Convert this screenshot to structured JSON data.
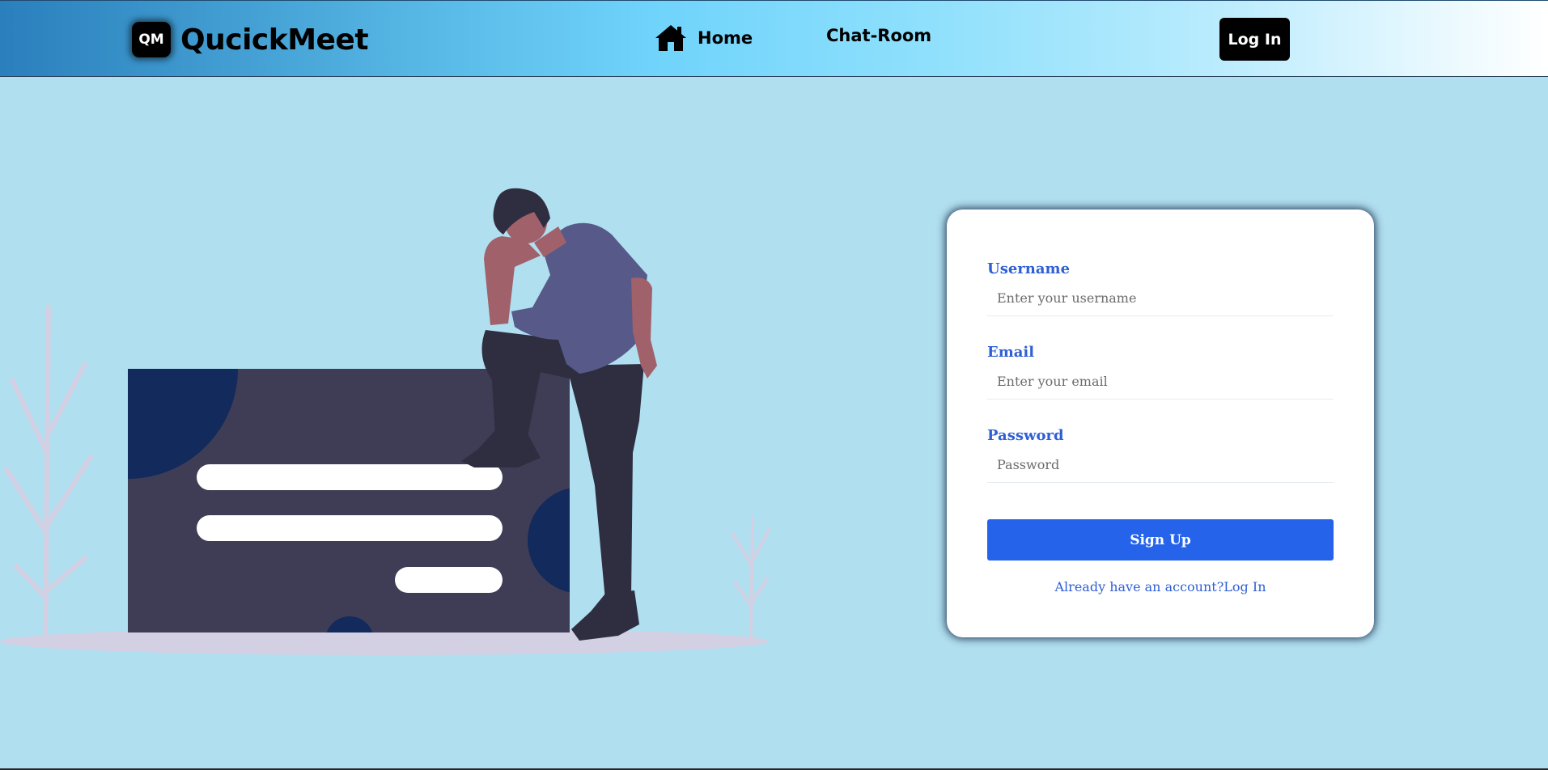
{
  "navbar": {
    "logo_badge": "QM",
    "brand_name": "QucickMeet",
    "home_icon": "home-icon",
    "home_label": "Home",
    "chat_label": "Chat-Room",
    "login_label": "Log In"
  },
  "form": {
    "username_label": "Username",
    "username_placeholder": "Enter your username",
    "email_label": "Email",
    "email_placeholder": "Enter your email",
    "password_label": "Password",
    "password_placeholder": "Password",
    "signup_label": "Sign Up",
    "already_text": "Already have an account?",
    "login_link_label": "Log In"
  },
  "colors": {
    "page_background": "#b0dff0",
    "accent_blue": "#2563eb",
    "label_blue": "#2f5fd4",
    "illustration_box": "#3f3d56",
    "illustration_shirt": "#575a89",
    "illustration_dark": "#2f2e41"
  }
}
